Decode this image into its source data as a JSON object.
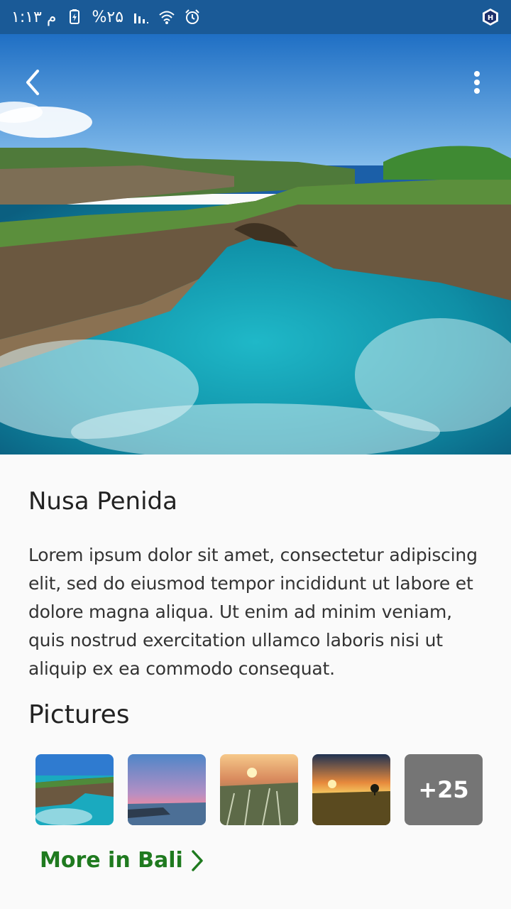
{
  "status_bar": {
    "time": "م ۱:۱۳",
    "battery": "%۲۵",
    "background": "#1a5a97"
  },
  "icons": {
    "back": "chevron-left-icon",
    "more": "kebab-menu-icon",
    "more_link": "chevron-right-icon"
  },
  "place": {
    "title": "Nusa Penida",
    "description": "Lorem ipsum dolor sit amet, consectetur adipiscing elit, sed do eiusmod tempor incididunt ut labore et dolore magna aliqua. Ut enim ad minim veniam, quis nostrud exercitation ullamco laboris nisi ut aliquip ex ea commodo consequat."
  },
  "pictures": {
    "heading": "Pictures",
    "more_count": "+25"
  },
  "more_link": {
    "label": "More in Bali",
    "color": "#1f7a1f"
  }
}
